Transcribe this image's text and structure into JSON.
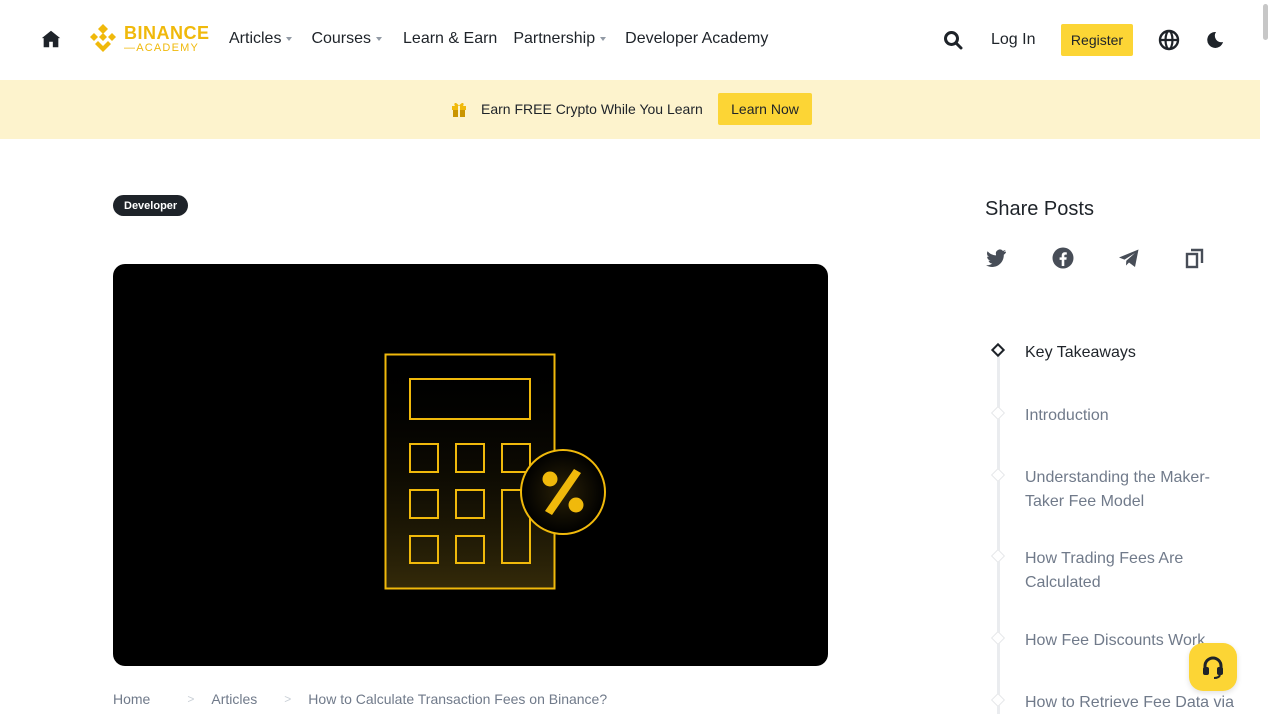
{
  "header": {
    "logo": {
      "line1": "BINANCE",
      "line2": "ACADEMY"
    },
    "nav": [
      {
        "label": "Articles",
        "dropdown": true
      },
      {
        "label": "Courses",
        "dropdown": true
      },
      {
        "label": "Learn & Earn",
        "dropdown": false
      },
      {
        "label": "Partnership",
        "dropdown": true
      },
      {
        "label": "Developer Academy",
        "dropdown": false
      }
    ],
    "login_label": "Log In",
    "register_label": "Register"
  },
  "banner": {
    "text": "Earn FREE Crypto While You Learn",
    "button_label": "Learn Now"
  },
  "article": {
    "category_tag": "Developer",
    "hero_icon": "calculator-percent-illustration",
    "breadcrumb": [
      "Home",
      "Articles",
      "How to Calculate Transaction Fees on Binance?"
    ]
  },
  "sidebar": {
    "share_title": "Share Posts",
    "share_icons": [
      "twitter-icon",
      "facebook-icon",
      "telegram-icon",
      "copy-link-icon"
    ],
    "toc": [
      {
        "label": "Key Takeaways",
        "active": true
      },
      {
        "label": "Introduction",
        "active": false
      },
      {
        "label": "Understanding the Maker-Taker Fee Model",
        "active": false
      },
      {
        "label": "How Trading Fees Are Calculated",
        "active": false
      },
      {
        "label": "How Fee Discounts Work",
        "active": false
      },
      {
        "label": "How to Retrieve Fee Data via",
        "active": false
      }
    ]
  },
  "colors": {
    "accent": "#fcd535",
    "brand": "#f0b90b",
    "banner_bg": "#fdf3cd",
    "text": "#1e2329",
    "muted": "#707a8a"
  }
}
